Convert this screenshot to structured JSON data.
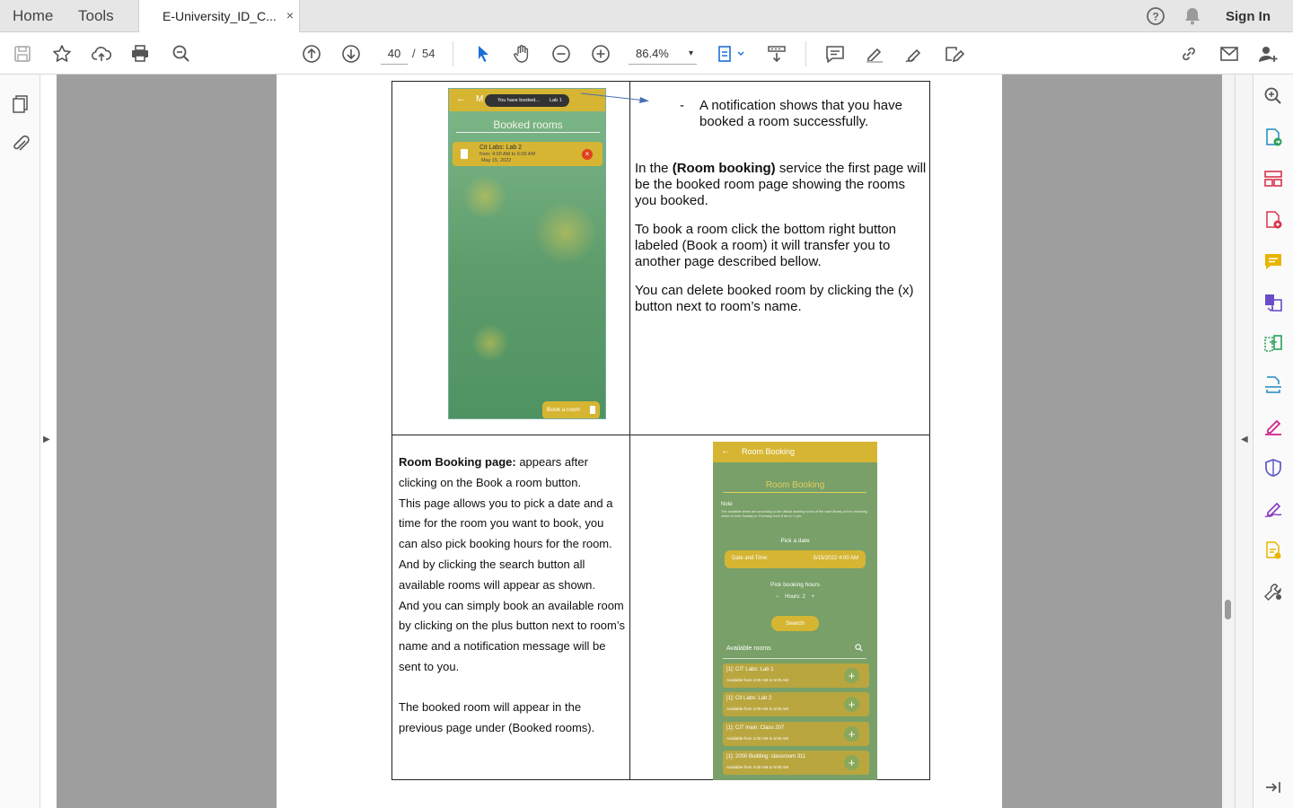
{
  "tabs": {
    "home": "Home",
    "tools": "Tools",
    "document": "E-University_ID_C...",
    "close": "×"
  },
  "header_right": {
    "help_icon": "help-icon",
    "bell_icon": "bell-icon",
    "sign_in": "Sign In"
  },
  "toolbar": {
    "page_current": "40",
    "page_separator": "/",
    "page_total": "54",
    "zoom": "86.4%",
    "zoom_caret": "▾"
  },
  "document": {
    "top_right": {
      "bullet_dash": "-",
      "bullet": "A notification shows that you have booked a room successfully.",
      "p1_pre": "In the ",
      "p1_bold": "(Room booking)",
      "p1_post": " service the first page will be the booked room page showing the rooms you booked.",
      "p2": "To book a room click the bottom right button labeled (Book a room) it will transfer you to another page described bellow.",
      "p3": "You can delete booked room by clicking the (x) button next to room’s name."
    },
    "bottom_left": {
      "heading_bold": "Room Booking page:",
      "heading_rest": " appears after clicking on the Book a room button.",
      "p1": "This page allows you to pick a date and a time for the room you want to book, you can also pick booking hours for the room.",
      "p2": "And by clicking the search button all available rooms will appear as shown.",
      "p3": "And you can simply book an available room by clicking on the plus button next to room’s name and a notification message will be sent to you.",
      "p4": "The booked room will appear in the previous page under (Booked rooms)."
    }
  },
  "phone1": {
    "back": "←",
    "header_initial": "M",
    "toast": "You have booked...",
    "toast_lab": "Lab 1",
    "title": "Booked rooms",
    "booked": {
      "name": "Cit Labs: Lab 2",
      "time": "from: 4:00 AM to 6:00 AM",
      "date": "May 15, 2022",
      "delete": "×"
    },
    "book_button": "Book a room"
  },
  "phone2": {
    "back": "←",
    "header_title": "Room Booking",
    "title": "Room Booking",
    "note_label": "Note",
    "note_text": "The available times are according to the official working hours of the main library of the university, which is from Sunday to Thursday from 8 am to 3 pm.",
    "pick_date": "Pick a date",
    "date_label": "Date and Time:",
    "date_value": "5/15/2022 4:00 AM",
    "pick_hours": "Pick booking hours",
    "hours_minus": "−",
    "hours": "Hours: 2",
    "hours_plus": "+",
    "search": "Search",
    "available_label": "Available rooms",
    "rooms": [
      {
        "name": "[1]: CIT Labs: Lab 1",
        "avail": "Available from 4:00 AM to 6:00 AM"
      },
      {
        "name": "[1]: Cit Labs: Lab 2",
        "avail": "Available from 4:00 AM to 6:00 AM"
      },
      {
        "name": "[1]: CIT main: Class 207",
        "avail": "Available from 4:00 AM to 6:00 AM"
      },
      {
        "name": "[1]: 2000 Building: classroom 311",
        "avail": "Available from 4:00 AM to 6:00 AM"
      }
    ],
    "plus": "+"
  },
  "colors": {
    "accent_yellow": "#d6b533",
    "phone_green": "#78a068",
    "canvas_gray": "#9e9e9e"
  }
}
